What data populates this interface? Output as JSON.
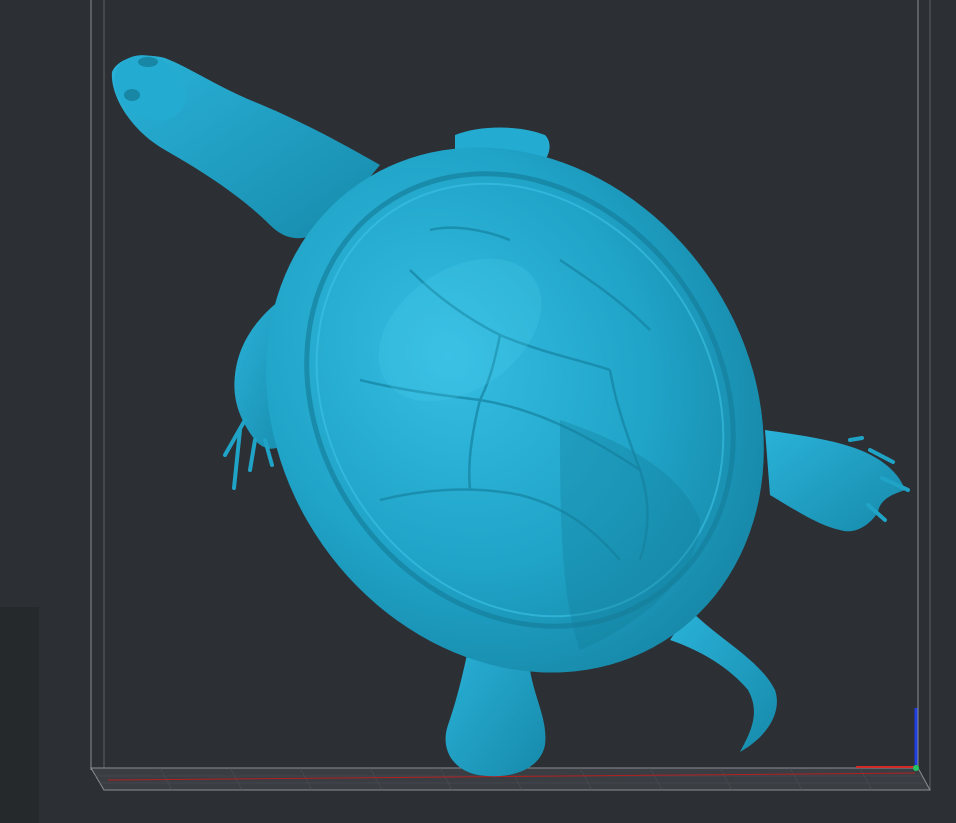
{
  "viewport": {
    "model_color": "#1fa3c7",
    "model_highlight": "#2fb6dc",
    "model_shadow": "#147d9b",
    "background": "#2c2f33",
    "build_volume_color": "#8a8f96",
    "axis_x_color": "#d42a2a",
    "axis_y_color": "#22c55e",
    "axis_z_color": "#1f3fe0"
  },
  "model": {
    "icon": "turtle-model"
  },
  "axes_gizmo": {
    "icon": "xyz-axis-icon"
  }
}
